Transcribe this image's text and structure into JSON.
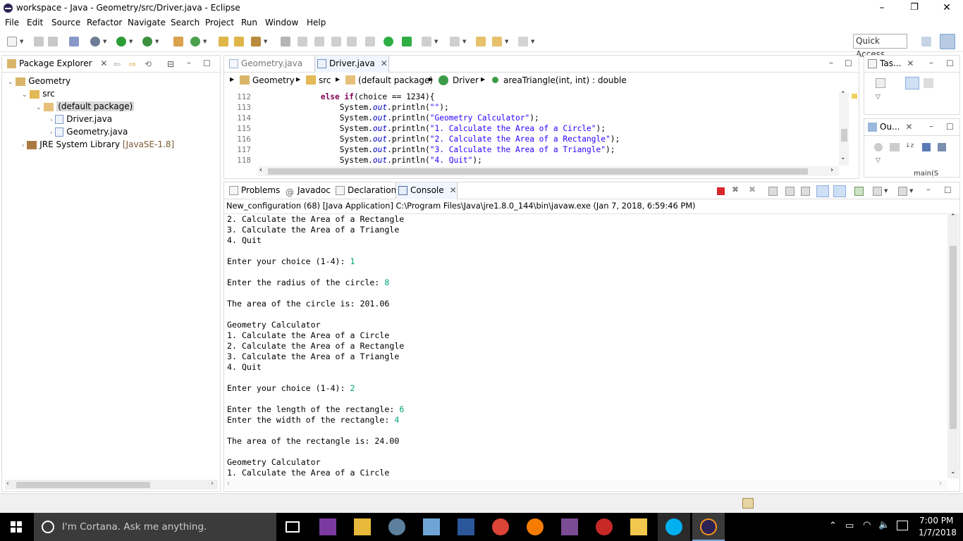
{
  "window": {
    "title": "workspace - Java - Geometry/src/Driver.java - Eclipse",
    "min": "–",
    "max": "❐",
    "close": "✕"
  },
  "menu": [
    "File",
    "Edit",
    "Source",
    "Refactor",
    "Navigate",
    "Search",
    "Project",
    "Run",
    "Window",
    "Help"
  ],
  "quick_access": "Quick Access",
  "package_explorer": {
    "tab": "Package Explorer",
    "tree": [
      {
        "label": "Geometry",
        "suffix": ""
      },
      {
        "label": "src",
        "suffix": ""
      },
      {
        "label": "(default package)",
        "suffix": ""
      },
      {
        "label": "Driver.java",
        "suffix": ""
      },
      {
        "label": "Geometry.java",
        "suffix": ""
      },
      {
        "label": "JRE System Library",
        "suffix": "[JavaSE-1.8]"
      }
    ]
  },
  "editor": {
    "tabs": [
      "Geometry.java",
      "Driver.java"
    ],
    "breadcrumb": [
      "Geometry",
      "src",
      "(default package)",
      "Driver",
      "areaTriangle(int, int) : double"
    ],
    "lines": [
      {
        "no": "112",
        "pre": "            ",
        "kw": "else if",
        "rest": "(choice == 1234){",
        "str": "",
        "post": ""
      },
      {
        "no": "113",
        "pre": "                System.",
        "fld": "out",
        "mid": ".println(",
        "str": "\"\"",
        "post": ");"
      },
      {
        "no": "114",
        "pre": "                System.",
        "fld": "out",
        "mid": ".println(",
        "str": "\"Geometry Calculator\"",
        "post": ");"
      },
      {
        "no": "115",
        "pre": "                System.",
        "fld": "out",
        "mid": ".println(",
        "str": "\"1. Calculate the Area of a Circle\"",
        "post": ");"
      },
      {
        "no": "116",
        "pre": "                System.",
        "fld": "out",
        "mid": ".println(",
        "str": "\"2. Calculate the Area of a Rectangle\"",
        "post": ");"
      },
      {
        "no": "117",
        "pre": "                System.",
        "fld": "out",
        "mid": ".println(",
        "str": "\"3. Calculate the Area of a Triangle\"",
        "post": ");"
      },
      {
        "no": "118",
        "pre": "                System.",
        "fld": "out",
        "mid": ".println(",
        "str": "\"4. Quit\"",
        "post": ");"
      }
    ]
  },
  "right_panels": {
    "tasks_tab": "Tas...",
    "outline_tab": "Ou...",
    "outline_item": "main(S"
  },
  "bottom": {
    "tabs": [
      "Problems",
      "Javadoc",
      "Declaration",
      "Console"
    ],
    "console_header": "New_configuration (68) [Java Application] C:\\Program Files\\Java\\jre1.8.0_144\\bin\\javaw.exe (Jan 7, 2018, 6:59:46 PM)",
    "console_lines": [
      {
        "t": "2. Calculate the Area of a Rectangle",
        "in": ""
      },
      {
        "t": "3. Calculate the Area of a Triangle",
        "in": ""
      },
      {
        "t": "4. Quit",
        "in": ""
      },
      {
        "t": "",
        "in": ""
      },
      {
        "t": "Enter your choice (1-4): ",
        "in": "1"
      },
      {
        "t": "",
        "in": ""
      },
      {
        "t": "Enter the radius of the circle: ",
        "in": "8"
      },
      {
        "t": "",
        "in": ""
      },
      {
        "t": "The area of the circle is: 201.06",
        "in": ""
      },
      {
        "t": "",
        "in": ""
      },
      {
        "t": "Geometry Calculator",
        "in": ""
      },
      {
        "t": "1. Calculate the Area of a Circle",
        "in": ""
      },
      {
        "t": "2. Calculate the Area of a Rectangle",
        "in": ""
      },
      {
        "t": "3. Calculate the Area of a Triangle",
        "in": ""
      },
      {
        "t": "4. Quit",
        "in": ""
      },
      {
        "t": "",
        "in": ""
      },
      {
        "t": "Enter your choice (1-4): ",
        "in": "2"
      },
      {
        "t": "",
        "in": ""
      },
      {
        "t": "Enter the length of the rectangle: ",
        "in": "6"
      },
      {
        "t": "Enter the width of the rectangle: ",
        "in": "4"
      },
      {
        "t": "",
        "in": ""
      },
      {
        "t": "The area of the rectangle is: 24.00",
        "in": ""
      },
      {
        "t": "",
        "in": ""
      },
      {
        "t": "Geometry Calculator",
        "in": ""
      },
      {
        "t": "1. Calculate the Area of a Circle",
        "in": ""
      }
    ]
  },
  "taskbar": {
    "cortana": "I'm Cortana. Ask me anything.",
    "time": "7:00 PM",
    "date": "1/7/2018"
  },
  "colors": {
    "keyword": "#7f0055",
    "string": "#2a00ff",
    "field": "#0000c0",
    "console_input": "#00a37a",
    "taskbar": "#000000"
  }
}
